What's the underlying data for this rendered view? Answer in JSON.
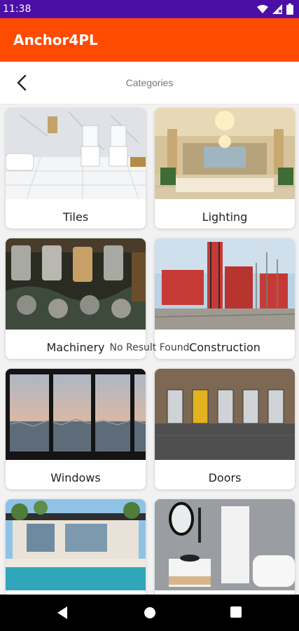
{
  "status": {
    "time": "11:38",
    "icons": [
      "wifi-icon",
      "signal-icon",
      "battery-icon"
    ]
  },
  "appbar": {
    "title": "Anchor4PL",
    "color": "#ff4b00"
  },
  "header": {
    "title": "Categories",
    "back_icon": "back-arrow-icon"
  },
  "categories": [
    {
      "label": "Tiles"
    },
    {
      "label": "Lighting"
    },
    {
      "label": "Machinery"
    },
    {
      "label": "Construction"
    },
    {
      "label": "Windows"
    },
    {
      "label": "Doors"
    },
    {
      "label": ""
    },
    {
      "label": ""
    }
  ],
  "empty_message": "No Result Found",
  "navbar": {
    "icons": [
      "back-triangle-icon",
      "home-circle-icon",
      "recents-square-icon"
    ]
  }
}
